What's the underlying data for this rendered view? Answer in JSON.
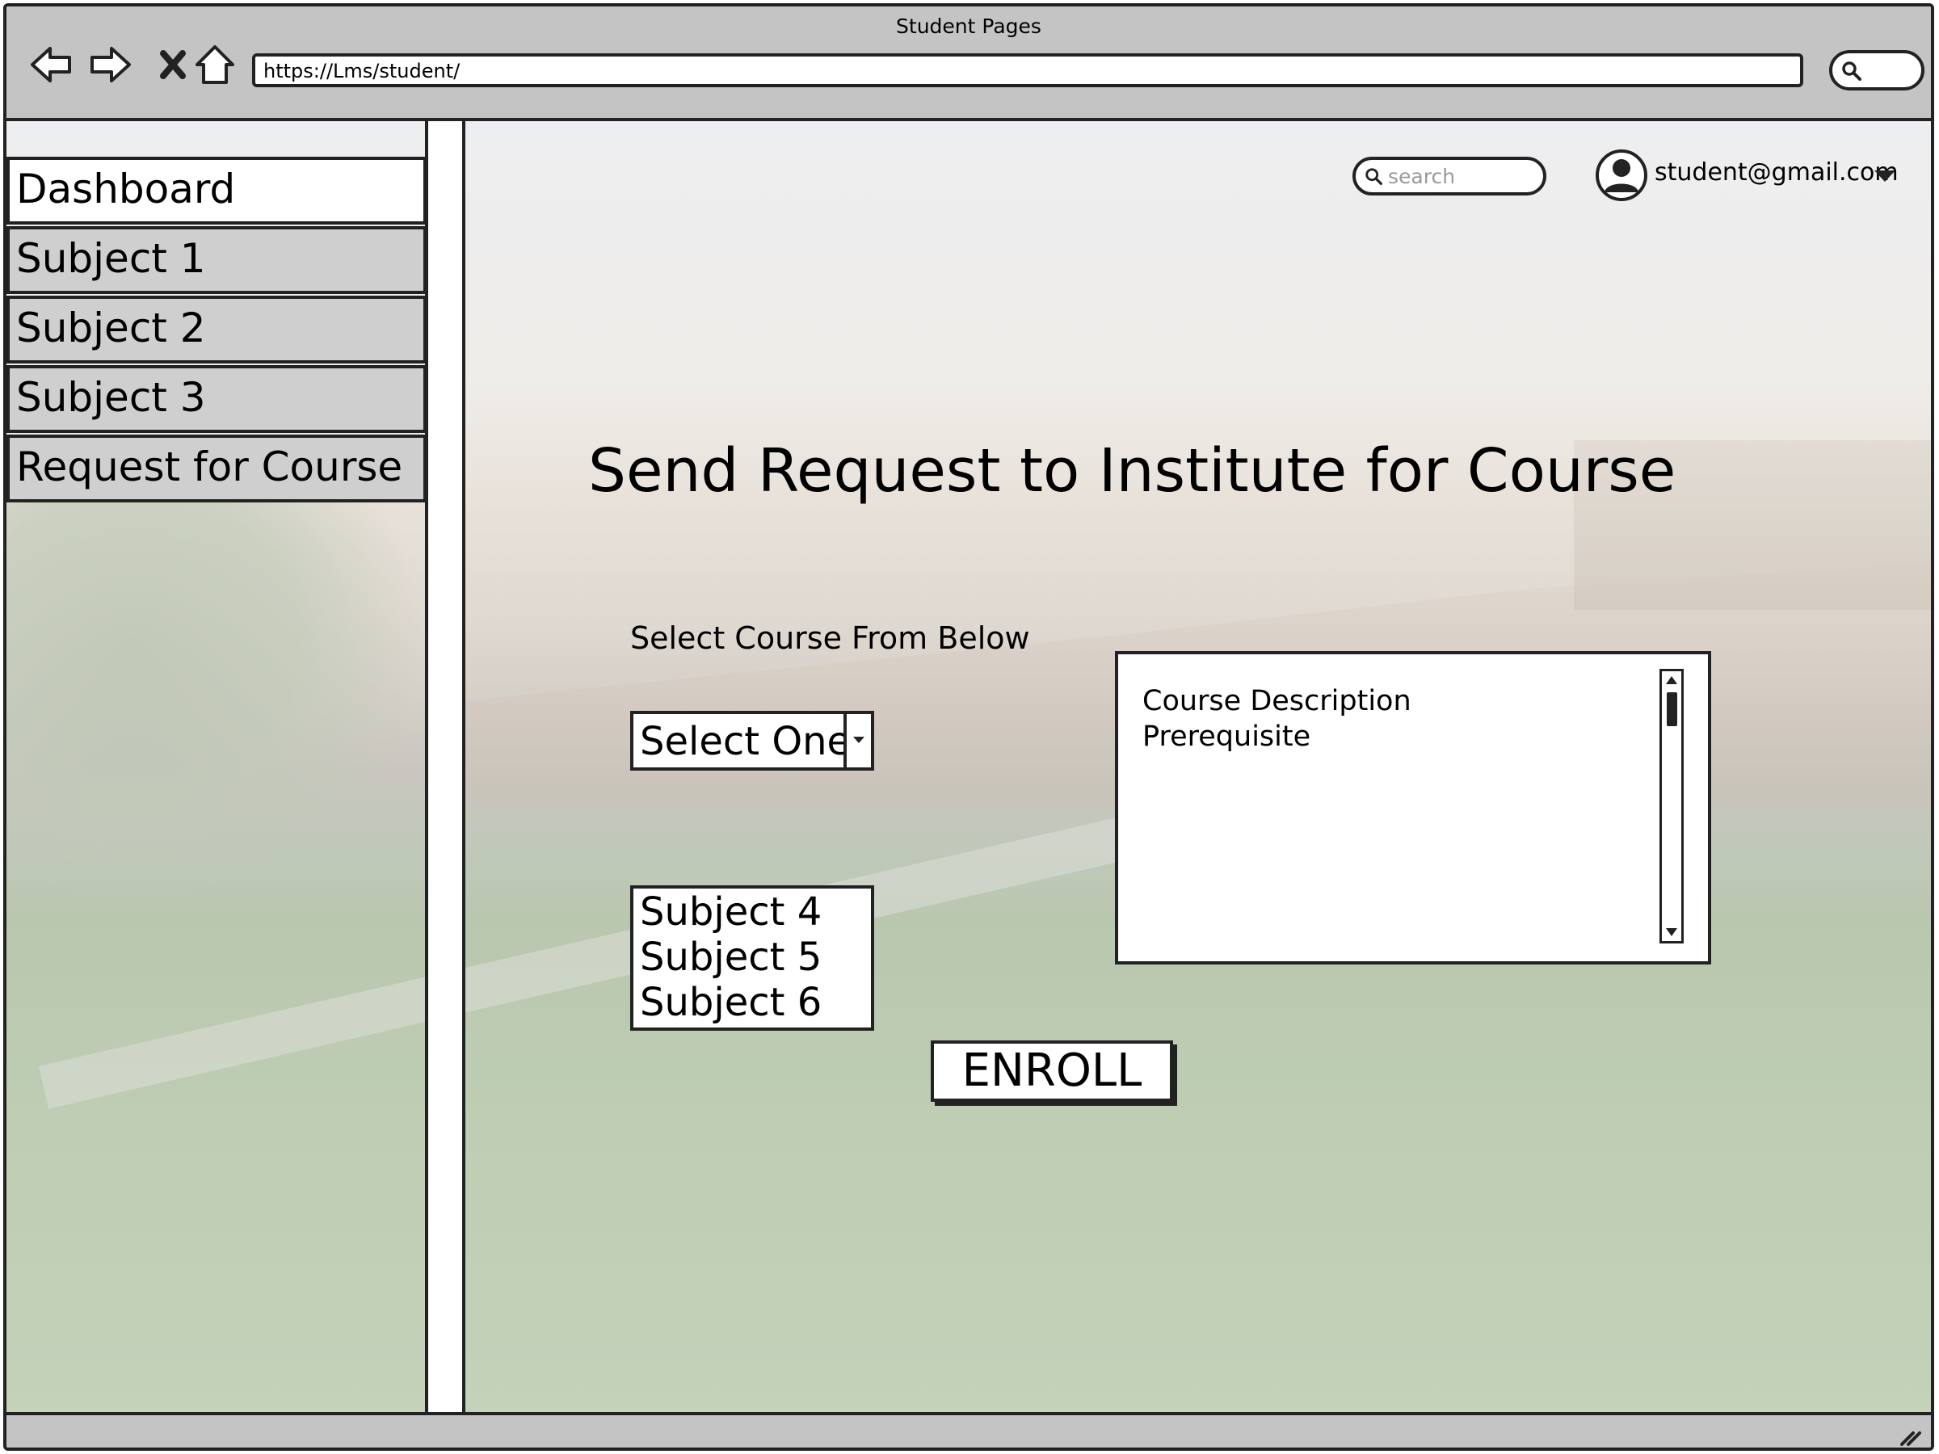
{
  "window": {
    "title": "Student Pages"
  },
  "browser": {
    "url": "https://Lms/student/",
    "buttons": {
      "back_icon": "back-arrow-icon",
      "forward_icon": "forward-arrow-icon",
      "stop_icon": "close-icon",
      "home_icon": "home-icon"
    }
  },
  "sidebar": {
    "items": [
      {
        "label": "Dashboard",
        "active": true
      },
      {
        "label": "Subject 1",
        "active": false
      },
      {
        "label": "Subject 2",
        "active": false
      },
      {
        "label": "Subject 3",
        "active": false
      },
      {
        "label": "Request for Course",
        "active": false
      }
    ]
  },
  "header": {
    "search_placeholder": "search",
    "user_email": "student@gmail.com"
  },
  "main": {
    "title": "Send Request to Institute for Course",
    "select_label": "Select Course From Below",
    "select_value": "Select One",
    "options": [
      "Subject 4",
      "Subject 5",
      "Subject 6"
    ],
    "description_lines": [
      "Course Description",
      "Prerequisite"
    ],
    "enroll_label": "ENROLL"
  }
}
